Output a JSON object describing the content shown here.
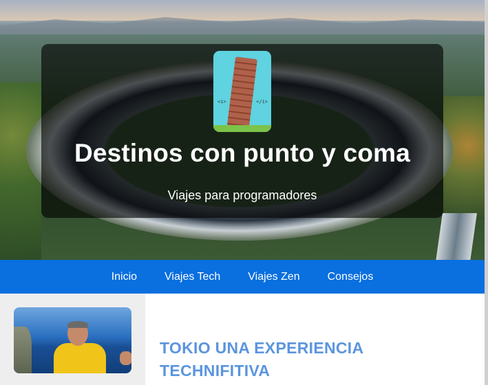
{
  "header": {
    "site_title": "Destinos con punto y coma",
    "tagline": "Viajes para programadores",
    "logo_code_left": "<i>",
    "logo_code_right": "</i>"
  },
  "nav": {
    "items": [
      {
        "label": "Inicio"
      },
      {
        "label": "Viajes Tech"
      },
      {
        "label": "Viajes Zen"
      },
      {
        "label": "Consejos"
      }
    ]
  },
  "main": {
    "post_title": "TOKIO UNA EXPERIENCIA TECHNIFITIVA"
  },
  "colors": {
    "nav_background": "#0a6fdf",
    "post_title": "#5b95de",
    "sidebar_background": "#eeeeee",
    "logo_background": "#5fd3e0"
  },
  "icons": {
    "logo": "leaning-tower-code-icon"
  }
}
